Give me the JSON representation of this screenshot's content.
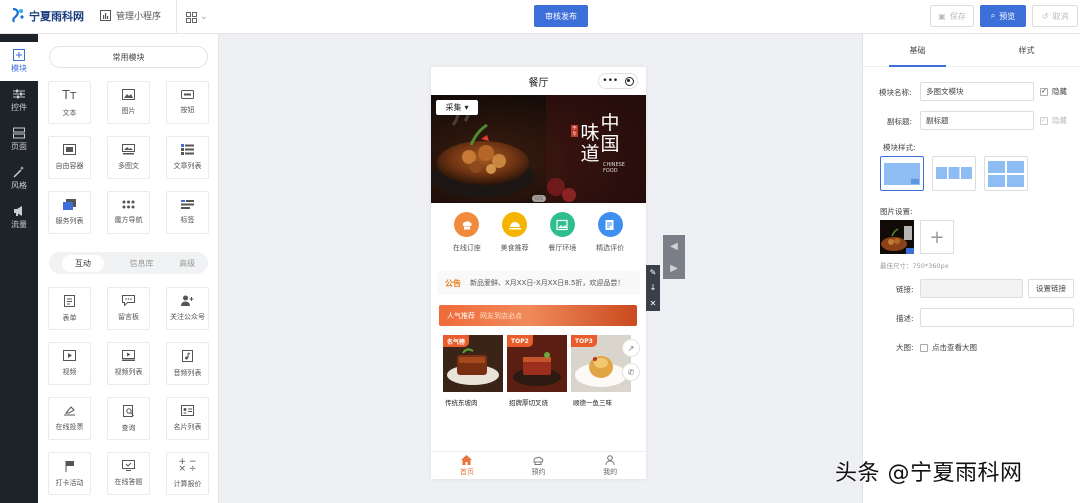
{
  "topbar": {
    "logo_text": "宁夏雨科网",
    "manage_label": "管理小程序",
    "publish_label": "审核发布",
    "save_label": "保存",
    "preview_label": "预览",
    "cancel_label": "取消"
  },
  "rail": {
    "items": [
      {
        "label": "模块",
        "icon": "plus-square-icon"
      },
      {
        "label": "控件",
        "icon": "sliders-icon"
      },
      {
        "label": "页面",
        "icon": "pages-icon"
      },
      {
        "label": "风格",
        "icon": "magic-wand-icon"
      },
      {
        "label": "流量",
        "icon": "megaphone-icon"
      }
    ]
  },
  "panel": {
    "common_title": "常用模块",
    "common": [
      "文本",
      "图片",
      "按钮",
      "自由容器",
      "多图文",
      "文章列表",
      "服务列表",
      "魔方导航",
      "标签"
    ],
    "tabs": [
      "互动",
      "信息库",
      "高级"
    ],
    "interactive": [
      "表单",
      "留言板",
      "关注公众号",
      "视频",
      "视频列表",
      "音频列表",
      "在线投票",
      "查询",
      "名片列表",
      "打卡活动",
      "在线答题",
      "计算报价"
    ]
  },
  "phone": {
    "title": "餐厅",
    "capsule_dots": "•••",
    "banner": {
      "collect_label": "采集",
      "cn_title_1": "中国",
      "cn_title_2": "味道",
      "seal_text": "中华",
      "sub_line_1": "CHINESE",
      "sub_line_2": "FOOD",
      "pager": "0/1"
    },
    "navs": [
      {
        "label": "在线订座",
        "color": "#f08a3c"
      },
      {
        "label": "美食推荐",
        "color": "#f5b400"
      },
      {
        "label": "餐厅环境",
        "color": "#2fbf8f"
      },
      {
        "label": "精选评价",
        "color": "#3f8ff0"
      }
    ],
    "notice": {
      "tag": "公告",
      "text": "新品爱鲜、X月XX日-X月XX日8.5折，欢迎品尝！"
    },
    "hot": {
      "title": "人气推荐",
      "subtitle": "网友到店必点"
    },
    "cards": [
      {
        "badge": "名气榜",
        "name": "传统东坡肉"
      },
      {
        "badge": "TOP2",
        "name": "招牌厚切叉烧"
      },
      {
        "badge": "TOP3",
        "name": "顺德一鱼三味"
      }
    ],
    "tabbar": [
      "首页",
      "预约",
      "我的"
    ]
  },
  "props": {
    "tabs": [
      "基础",
      "样式"
    ],
    "name_label": "模块名称:",
    "name_value": "多图文模块",
    "hide_label": "隐藏",
    "subtitle_label": "副标题:",
    "subtitle_value": "副标题",
    "style_label": "模块样式:",
    "image_label": "图片设置:",
    "size_hint": "最佳尺寸：750*360px",
    "link_label": "链接:",
    "set_link": "设置链接",
    "desc_label": "描述:",
    "bigimg_label": "大图:",
    "bigimg_check": "点击查看大图"
  },
  "watermark": "头条 @宁夏雨科网",
  "colors": {
    "accent": "#3d6fd9",
    "rail_bg": "#1e2229",
    "orange": "#e9743c"
  }
}
